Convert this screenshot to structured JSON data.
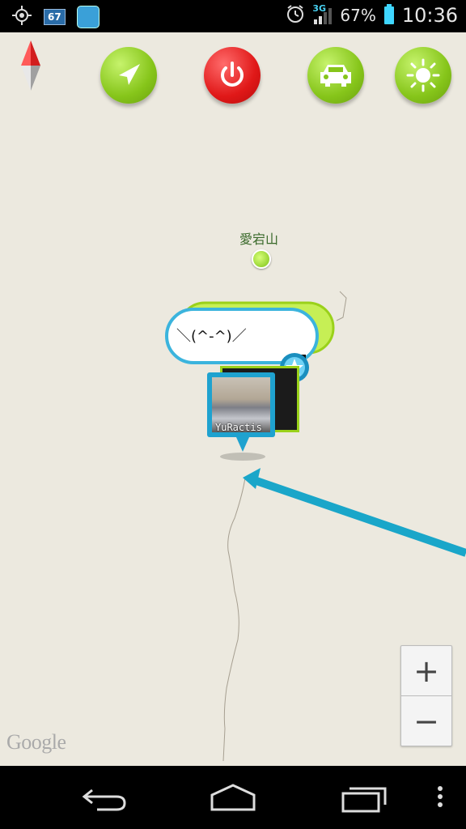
{
  "status_bar": {
    "notification_badge": "67",
    "network": "3G",
    "battery_percent": "67%",
    "clock": "10:36",
    "icons": [
      "gps-icon",
      "notification-67-icon",
      "app-icon",
      "alarm-icon",
      "signal-icon",
      "battery-icon"
    ]
  },
  "map": {
    "poi_label": "愛宕山",
    "bubble_text": "＼(^-^)／",
    "photo_caption": "YuRactis",
    "zoom_in_label": "+",
    "zoom_out_label": "−",
    "provider_logo": "Google"
  },
  "toolbar": {
    "buttons": [
      {
        "name": "navigation-button",
        "icon": "navigation-arrow-icon",
        "color": "#86c51a"
      },
      {
        "name": "power-button",
        "icon": "power-icon",
        "color": "#e01818"
      },
      {
        "name": "car-button",
        "icon": "car-icon",
        "color": "#86c51a"
      },
      {
        "name": "brightness-button",
        "icon": "sun-icon",
        "color": "#86c51a"
      }
    ]
  },
  "colors": {
    "map_background": "#ece9df",
    "route_blue": "#1aa6c9",
    "accent_green": "#86c51a",
    "accent_red": "#e01818"
  },
  "nav_bar": {
    "buttons": [
      "back-icon",
      "home-icon",
      "recent-apps-icon",
      "menu-icon"
    ]
  }
}
